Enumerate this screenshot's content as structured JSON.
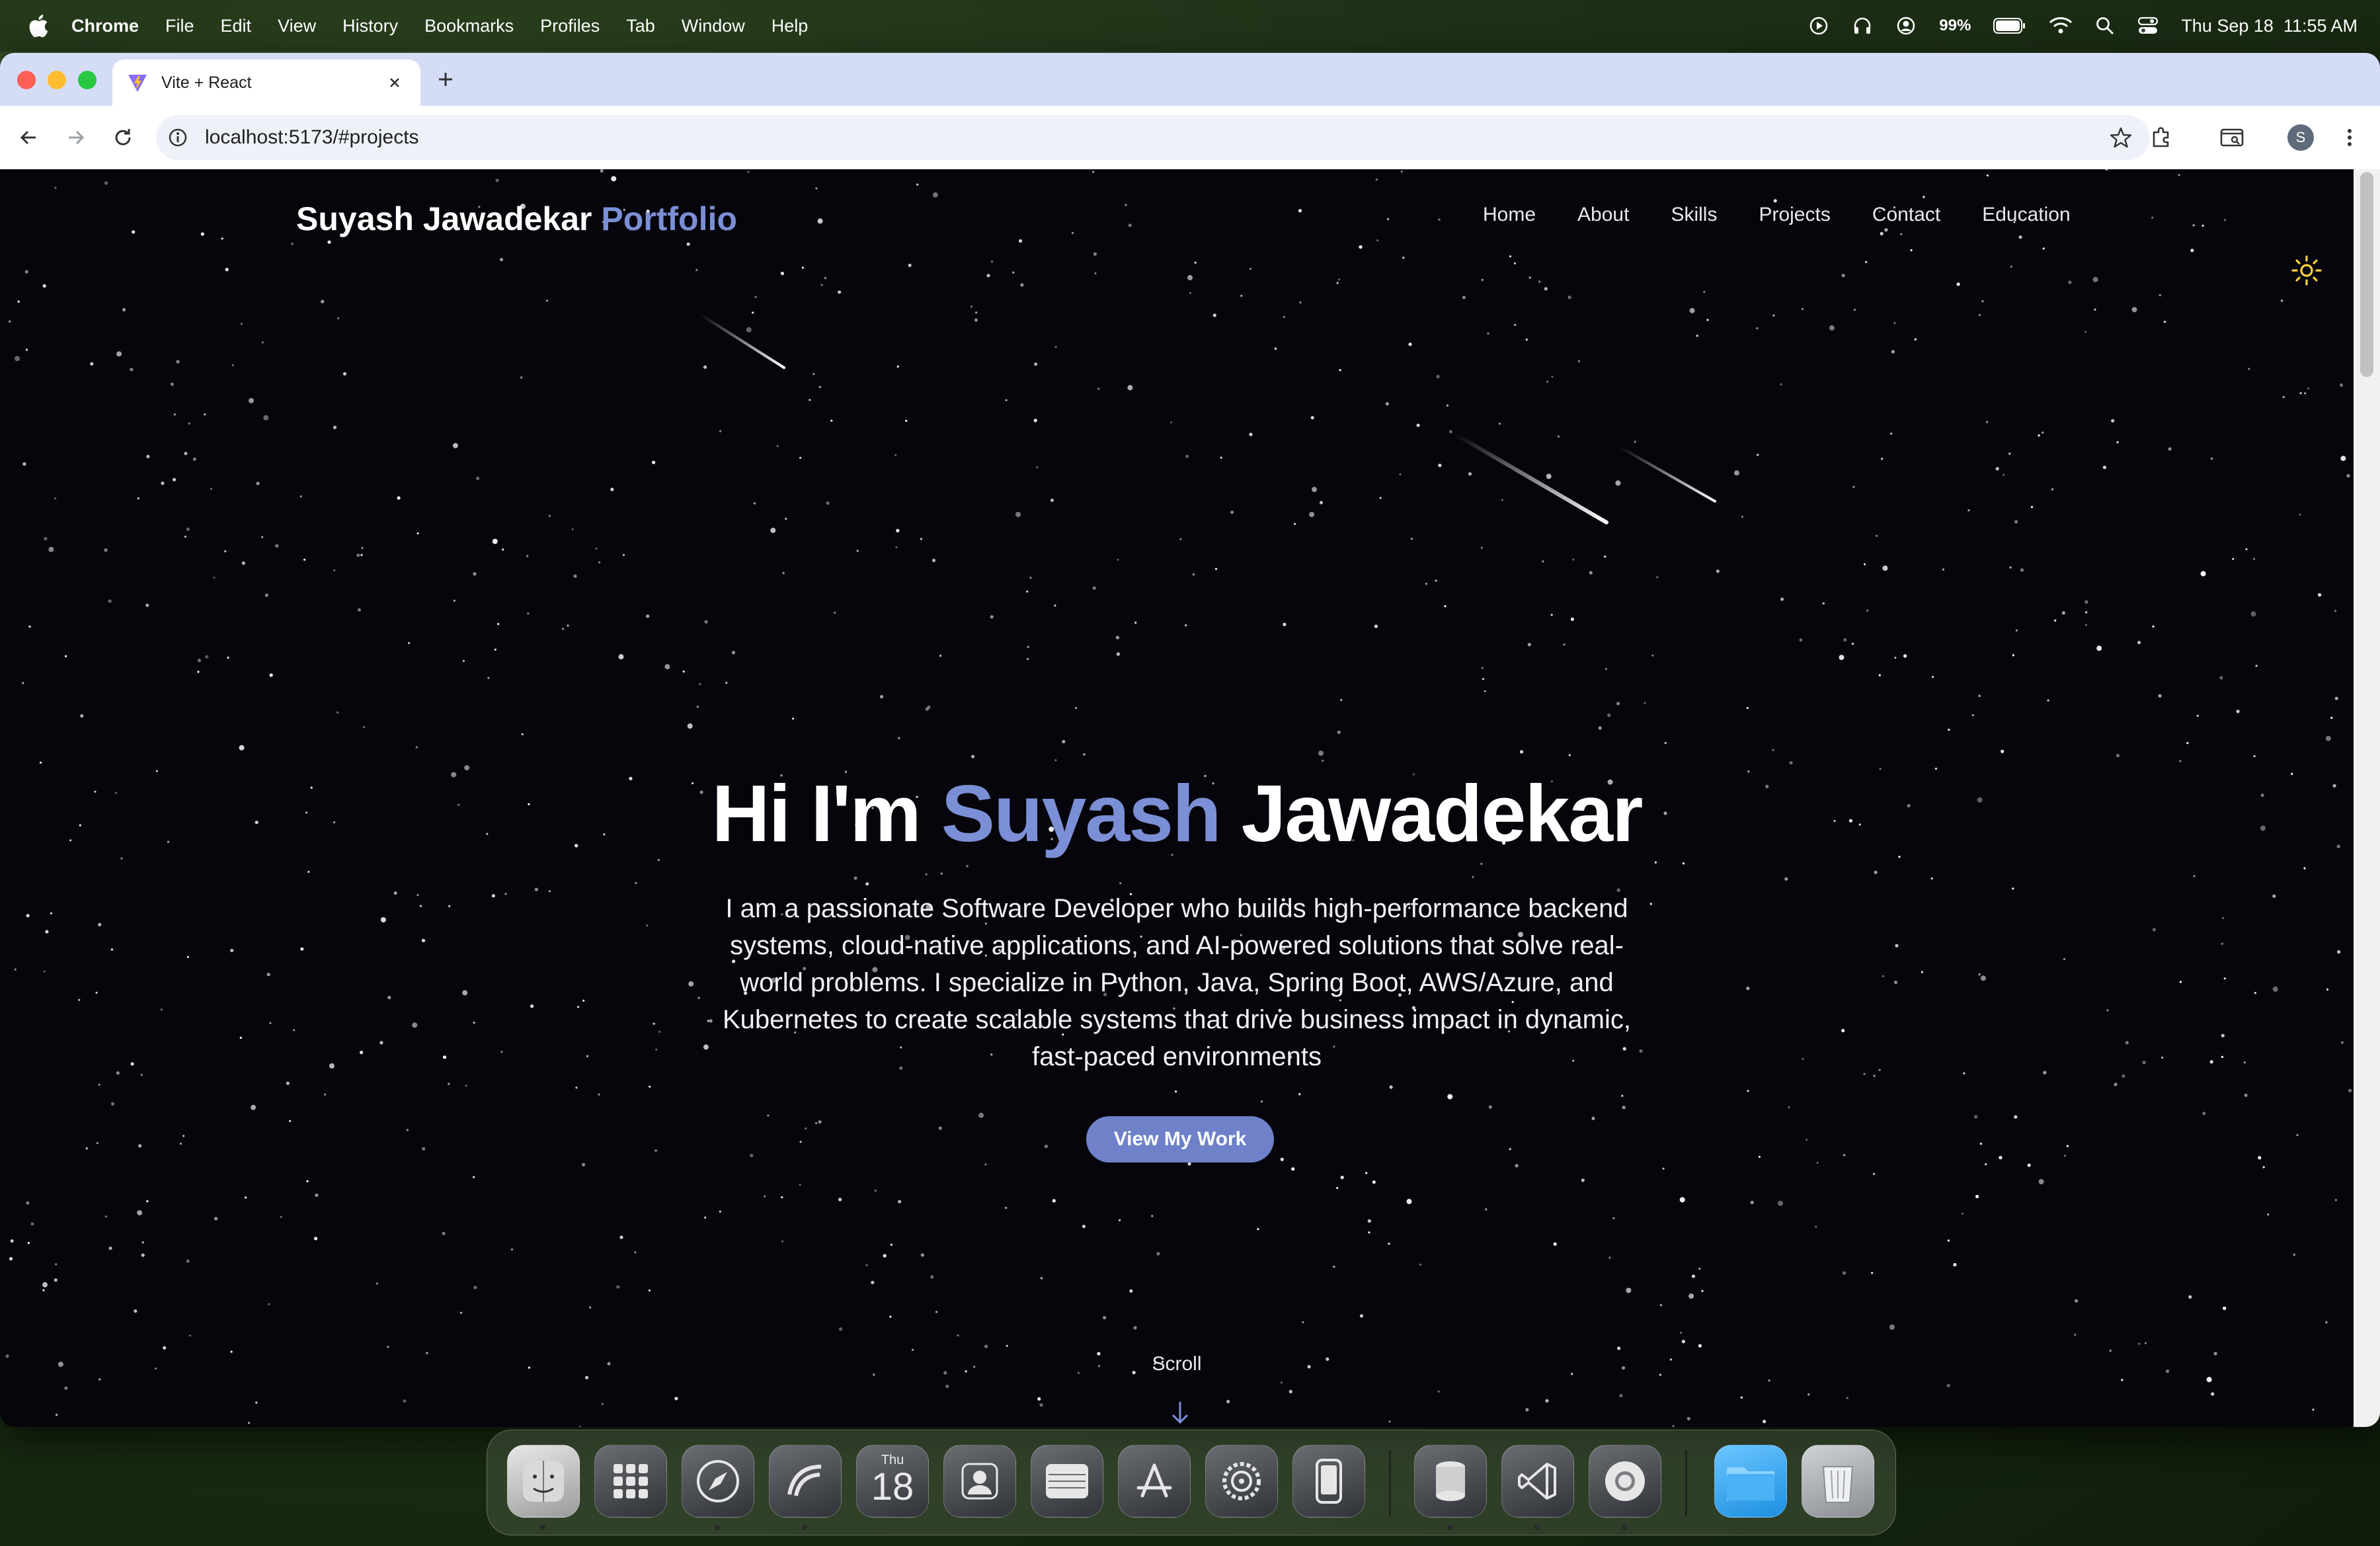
{
  "menubar": {
    "app_name": "Chrome",
    "items": [
      "File",
      "Edit",
      "View",
      "History",
      "Bookmarks",
      "Profiles",
      "Tab",
      "Window",
      "Help"
    ],
    "battery": "99%",
    "datetime": "Thu Sep 18  11:55 AM"
  },
  "browser": {
    "tab_title": "Vite + React",
    "url": "localhost:5173/#projects",
    "profile_initial": "S"
  },
  "site": {
    "brand_name": "Suyash Jawadekar",
    "brand_accent": "Portfolio",
    "nav": [
      "Home",
      "About",
      "Skills",
      "Projects",
      "Contact",
      "Education"
    ],
    "hero": {
      "greeting": "Hi I'm",
      "first_name": "Suyash",
      "last_name": "Jawadekar",
      "description": "I am a passionate Software Developer who builds high-performance backend systems, cloud-native applications, and AI-powered solutions that solve real-world problems. I specialize in Python, Java, Spring Boot, AWS/Azure, and Kubernetes to create scalable systems that drive business impact in dynamic, fast-paced environments",
      "cta": "View My Work"
    },
    "scroll_label": "Scroll",
    "colors": {
      "accent": "#7b8fd6",
      "button": "#6e81c9",
      "background": "#05050b"
    }
  },
  "dock": {
    "calendar_month": "Thu",
    "calendar_day": "18",
    "apps": [
      "finder-icon",
      "launchpad-icon",
      "safari-icon",
      "arc-icon",
      "calendar-icon",
      "contacts-icon",
      "notes-icon",
      "app-store-icon",
      "system-settings-icon",
      "simulator-icon",
      "disk-utility-icon",
      "vscode-icon",
      "chrome-icon",
      "downloads-folder-icon",
      "trash-icon"
    ]
  }
}
